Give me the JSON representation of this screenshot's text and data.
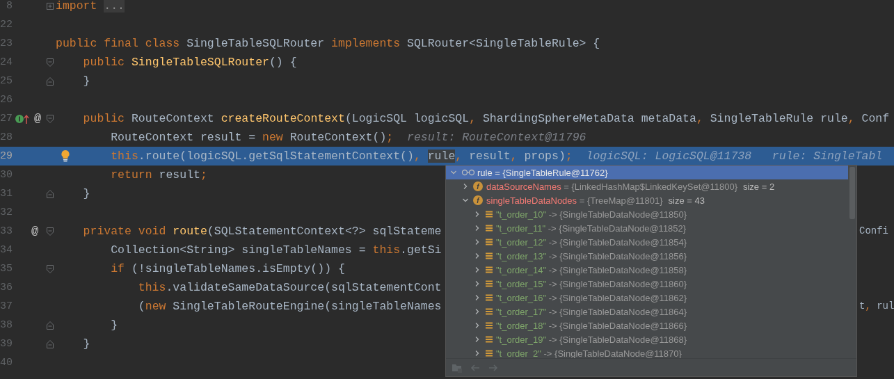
{
  "editor": {
    "lines": [
      {
        "number": "8",
        "current": false,
        "fold": {
          "kind": "collapsed"
        },
        "tokens": [
          {
            "kind": "keyword",
            "text": "import "
          },
          {
            "kind": "folded",
            "text": "..."
          }
        ]
      },
      {
        "number": "22",
        "current": false
      },
      {
        "number": "23",
        "current": false,
        "tokens": [
          {
            "kind": "keyword",
            "text": "public final class "
          },
          {
            "kind": "plain",
            "text": "SingleTableSQLRouter "
          },
          {
            "kind": "keyword",
            "text": "implements "
          },
          {
            "kind": "plain",
            "text": "SQLRouter<SingleTableRule> {"
          }
        ]
      },
      {
        "number": "24",
        "current": false,
        "fold": {
          "kind": "start"
        },
        "tokens": [
          {
            "kind": "keyword",
            "text": "    public "
          },
          {
            "kind": "method",
            "text": "SingleTableSQLRouter"
          },
          {
            "kind": "plain",
            "text": "() {"
          }
        ]
      },
      {
        "number": "25",
        "current": false,
        "fold": {
          "kind": "end"
        },
        "tokens": [
          {
            "kind": "plain",
            "text": "    }"
          }
        ]
      },
      {
        "number": "26",
        "current": false
      },
      {
        "number": "27",
        "current": false,
        "fold": {
          "kind": "start"
        },
        "gutter": [
          {
            "kind": "implements"
          },
          {
            "kind": "override",
            "text": "@"
          }
        ],
        "tokens": [
          {
            "kind": "keyword",
            "text": "    public "
          },
          {
            "kind": "plain",
            "text": "RouteContext "
          },
          {
            "kind": "method",
            "text": "createRouteContext"
          },
          {
            "kind": "plain",
            "text": "(LogicSQL logicSQL"
          },
          {
            "kind": "punct",
            "text": ", "
          },
          {
            "kind": "plain",
            "text": "ShardingSphereMetaData metaData"
          },
          {
            "kind": "punct",
            "text": ", "
          },
          {
            "kind": "plain",
            "text": "SingleTableRule rule"
          },
          {
            "kind": "punct",
            "text": ", "
          },
          {
            "kind": "plain",
            "text": "Conf"
          }
        ]
      },
      {
        "number": "28",
        "current": false,
        "tokens": [
          {
            "kind": "plain",
            "text": "        RouteContext result = "
          },
          {
            "kind": "keyword",
            "text": "new "
          },
          {
            "kind": "plain",
            "text": "RouteContext()"
          },
          {
            "kind": "punct",
            "text": ";"
          },
          {
            "kind": "hint",
            "text": "  result: RouteContext@11796"
          }
        ]
      },
      {
        "number": "29",
        "current": true,
        "gutter": [
          {
            "kind": "bulb"
          }
        ],
        "tokens": [
          {
            "kind": "keyword",
            "text": "        this"
          },
          {
            "kind": "plain",
            "text": ".route(logicSQL.getSqlStatementContext()"
          },
          {
            "kind": "punct",
            "text": ", "
          },
          {
            "kind": "marked",
            "text": "rule"
          },
          {
            "kind": "punct",
            "text": ", "
          },
          {
            "kind": "plain",
            "text": "result"
          },
          {
            "kind": "punct",
            "text": ", "
          },
          {
            "kind": "plain",
            "text": "props)"
          },
          {
            "kind": "punct",
            "text": ";"
          },
          {
            "kind": "hint",
            "text": "  logicSQL: LogicSQL@11738   rule: SingleTabl"
          }
        ]
      },
      {
        "number": "30",
        "current": false,
        "tokens": [
          {
            "kind": "keyword",
            "text": "        return "
          },
          {
            "kind": "plain",
            "text": "result"
          },
          {
            "kind": "punct",
            "text": ";"
          }
        ]
      },
      {
        "number": "31",
        "current": false,
        "fold": {
          "kind": "end"
        },
        "tokens": [
          {
            "kind": "plain",
            "text": "    }"
          }
        ]
      },
      {
        "number": "32",
        "current": false
      },
      {
        "number": "33",
        "current": false,
        "fold": {
          "kind": "start"
        },
        "gutter": [
          {
            "kind": "override",
            "text": "@"
          }
        ],
        "tokens": [
          {
            "kind": "keyword",
            "text": "    private void "
          },
          {
            "kind": "method",
            "text": "route"
          },
          {
            "kind": "plain",
            "text": "(SQLStatementContext<?> sqlStateme"
          }
        ],
        "tail": [
          {
            "kind": "plain",
            "text": "Confi"
          }
        ]
      },
      {
        "number": "34",
        "current": false,
        "tokens": [
          {
            "kind": "plain",
            "text": "        Collection<String> singleTableNames = "
          },
          {
            "kind": "keyword",
            "text": "this"
          },
          {
            "kind": "plain",
            "text": ".getSi"
          }
        ]
      },
      {
        "number": "35",
        "current": false,
        "fold": {
          "kind": "start"
        },
        "tokens": [
          {
            "kind": "keyword",
            "text": "        if "
          },
          {
            "kind": "plain",
            "text": "(!singleTableNames.isEmpty()) {"
          }
        ]
      },
      {
        "number": "36",
        "current": false,
        "tokens": [
          {
            "kind": "keyword",
            "text": "            this"
          },
          {
            "kind": "plain",
            "text": ".validateSameDataSource(sqlStatementCont"
          }
        ]
      },
      {
        "number": "37",
        "current": false,
        "tokens": [
          {
            "kind": "plain",
            "text": "            ("
          },
          {
            "kind": "keyword",
            "text": "new "
          },
          {
            "kind": "plain",
            "text": "SingleTableRouteEngine(singleTableNames"
          }
        ],
        "tail": [
          {
            "kind": "plain",
            "text": "t"
          },
          {
            "kind": "punct",
            "text": ", "
          },
          {
            "kind": "plain",
            "text": "rul"
          }
        ]
      },
      {
        "number": "38",
        "current": false,
        "fold": {
          "kind": "end"
        },
        "tokens": [
          {
            "kind": "plain",
            "text": "        }"
          }
        ]
      },
      {
        "number": "39",
        "current": false,
        "fold": {
          "kind": "end"
        },
        "tokens": [
          {
            "kind": "plain",
            "text": "    }"
          }
        ]
      },
      {
        "number": "40",
        "current": false
      }
    ]
  },
  "variables_popup": {
    "tree": [
      {
        "kind": "watch",
        "name": "rule",
        "separator": "=",
        "value": "{SingleTableRule@11762}",
        "expanded": true,
        "selected": true,
        "children": [
          {
            "kind": "field",
            "icon_text": "f",
            "name": "dataSourceNames",
            "separator": "=",
            "value": "{LinkedHashMap$LinkedKeySet@11800}",
            "size": "size = 2",
            "expanded": false,
            "selected": false
          },
          {
            "kind": "field",
            "icon_text": "f",
            "name": "singleTableDataNodes",
            "separator": "=",
            "value": "{TreeMap@11801}",
            "size": "size = 43",
            "expanded": true,
            "selected": false,
            "children": [
              {
                "kind": "entry",
                "name": "\"t_order_10\"",
                "separator": "->",
                "value": "{SingleTableDataNode@11850}",
                "expanded": false,
                "selected": false
              },
              {
                "kind": "entry",
                "name": "\"t_order_11\"",
                "separator": "->",
                "value": "{SingleTableDataNode@11852}",
                "expanded": false,
                "selected": false
              },
              {
                "kind": "entry",
                "name": "\"t_order_12\"",
                "separator": "->",
                "value": "{SingleTableDataNode@11854}",
                "expanded": false,
                "selected": false
              },
              {
                "kind": "entry",
                "name": "\"t_order_13\"",
                "separator": "->",
                "value": "{SingleTableDataNode@11856}",
                "expanded": false,
                "selected": false
              },
              {
                "kind": "entry",
                "name": "\"t_order_14\"",
                "separator": "->",
                "value": "{SingleTableDataNode@11858}",
                "expanded": false,
                "selected": false
              },
              {
                "kind": "entry",
                "name": "\"t_order_15\"",
                "separator": "->",
                "value": "{SingleTableDataNode@11860}",
                "expanded": false,
                "selected": false
              },
              {
                "kind": "entry",
                "name": "\"t_order_16\"",
                "separator": "->",
                "value": "{SingleTableDataNode@11862}",
                "expanded": false,
                "selected": false
              },
              {
                "kind": "entry",
                "name": "\"t_order_17\"",
                "separator": "->",
                "value": "{SingleTableDataNode@11864}",
                "expanded": false,
                "selected": false
              },
              {
                "kind": "entry",
                "name": "\"t_order_18\"",
                "separator": "->",
                "value": "{SingleTableDataNode@11866}",
                "expanded": false,
                "selected": false
              },
              {
                "kind": "entry",
                "name": "\"t_order_19\"",
                "separator": "->",
                "value": "{SingleTableDataNode@11868}",
                "expanded": false,
                "selected": false
              },
              {
                "kind": "entry",
                "name": "\"t_order_2\"",
                "separator": "->",
                "value": "{SingleTableDataNode@11870}",
                "expanded": false,
                "selected": false
              }
            ]
          }
        ]
      }
    ]
  }
}
